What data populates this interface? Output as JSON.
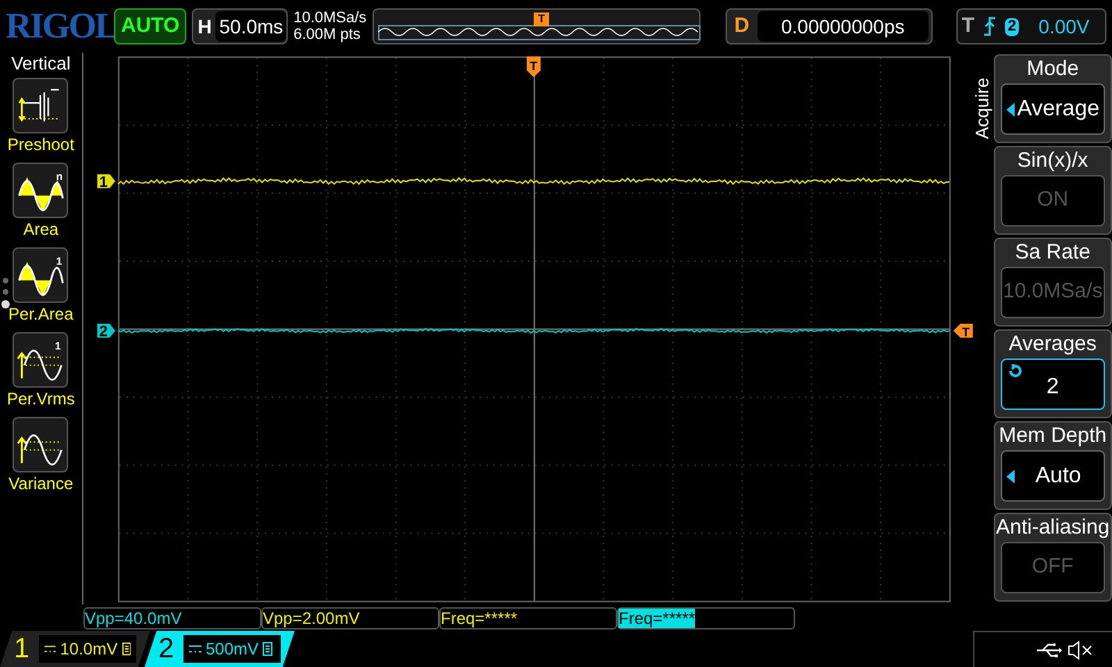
{
  "header": {
    "logo": "RIGOL",
    "run_status": "AUTO",
    "horizontal": {
      "label": "H",
      "value": "50.0ms"
    },
    "sample_rate": "10.0MSa/s",
    "memory_depth": "6.00M pts",
    "delay": {
      "label": "D",
      "value": "0.00000000ps"
    },
    "trigger": {
      "label": "T",
      "source": "2",
      "level": "0.00V"
    },
    "overview_marker": "T"
  },
  "left_menu": {
    "title": "Vertical",
    "items": [
      {
        "label": "Preshoot",
        "kind": "preshoot"
      },
      {
        "label": "Area",
        "kind": "area",
        "icon_mark": "n"
      },
      {
        "label": "Per.Area",
        "kind": "per_area",
        "icon_mark": "1"
      },
      {
        "label": "Per.Vrms",
        "kind": "per_vrms",
        "icon_mark": "1"
      },
      {
        "label": "Variance",
        "kind": "variance"
      }
    ],
    "pages": [
      {
        "selected": false
      },
      {
        "selected": false
      },
      {
        "selected": true
      }
    ]
  },
  "waveform": {
    "trigger_marker": "T",
    "trigger_level_marker": "T",
    "traces": [
      {
        "marker": "1",
        "color": "#e0e000"
      },
      {
        "marker": "2",
        "color": "#00c8c8"
      }
    ]
  },
  "measurements": [
    {
      "text": "Vpp=40.0mV",
      "kind": "cyan",
      "selected": false
    },
    {
      "text": "Vpp=2.00mV",
      "kind": "yellow",
      "selected": false
    },
    {
      "text": "Freq=*****",
      "kind": "yellow",
      "selected": false
    },
    {
      "text": "Freq=*****",
      "kind": "cyan",
      "selected": true
    }
  ],
  "right_menu": {
    "title": "Acquire",
    "items": [
      {
        "label": "Mode",
        "value": "Average",
        "kind": "select"
      },
      {
        "label": "Sin(x)/x",
        "value": "ON",
        "kind": "readonly"
      },
      {
        "label": "Sa Rate",
        "value": "10.0MSa/s",
        "kind": "readonly"
      },
      {
        "label": "Averages",
        "value": "2",
        "kind": "knob"
      },
      {
        "label": "Mem Depth",
        "value": "Auto",
        "kind": "select"
      },
      {
        "label": "Anti-aliasing",
        "value": "OFF",
        "kind": "readonly"
      }
    ]
  },
  "channels": [
    {
      "number": "1",
      "scale": "10.0mV",
      "color": "#f0f000",
      "selected": false
    },
    {
      "number": "2",
      "scale": "500mV",
      "color": "#00e8f0",
      "selected": true
    }
  ]
}
